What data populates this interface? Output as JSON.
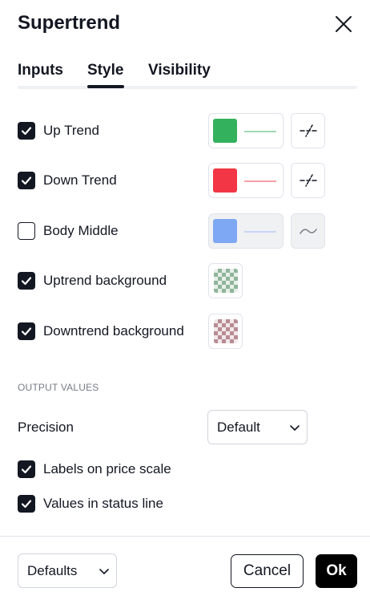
{
  "dialog": {
    "title": "Supertrend"
  },
  "tabs": [
    {
      "label": "Inputs",
      "active": false
    },
    {
      "label": "Style",
      "active": true
    },
    {
      "label": "Visibility",
      "active": false
    }
  ],
  "style_rows": [
    {
      "label": "Up Trend",
      "checked": true,
      "color": "#34b15d"
    },
    {
      "label": "Down Trend",
      "checked": true,
      "color": "#f23645"
    },
    {
      "label": "Body Middle",
      "checked": false,
      "color": "#7fa8f4"
    },
    {
      "label": "Uptrend background",
      "checked": true,
      "color": "#8fb59a"
    },
    {
      "label": "Downtrend background",
      "checked": true,
      "color": "#b88c94"
    }
  ],
  "output_values": {
    "section_title": "OUTPUT VALUES",
    "precision_label": "Precision",
    "precision_value": "Default",
    "labels_on_price_scale": {
      "label": "Labels on price scale",
      "checked": true
    },
    "values_in_status_line": {
      "label": "Values in status line",
      "checked": true
    }
  },
  "footer": {
    "defaults_label": "Defaults",
    "cancel_label": "Cancel",
    "ok_label": "Ok"
  }
}
